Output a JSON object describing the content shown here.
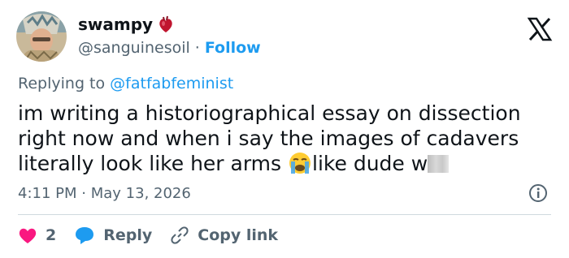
{
  "author": {
    "name": "swampy",
    "handle": "@sanguinesoil",
    "separator": "·",
    "follow_label": "Follow"
  },
  "reply": {
    "prefix": "Replying to",
    "mention": "@fatfabfeminist"
  },
  "tweet": {
    "text_part1": "im writing a historiographical essay on dissection right now and when i say the images of cadavers literally look like her arms ",
    "text_part2": "like dude w"
  },
  "meta": {
    "time": "4:11 PM",
    "separator": "·",
    "date": "May 13, 2026"
  },
  "actions": {
    "like_count": "2",
    "reply_label": "Reply",
    "copy_label": "Copy link"
  },
  "colors": {
    "accent": "#1d9bf0",
    "like": "#f91880",
    "muted": "#536471",
    "text": "#0f1419"
  },
  "icons": [
    "avatar-image",
    "anatomical-heart-icon",
    "x-logo-icon",
    "loudly-crying-face-emoji",
    "info-icon",
    "heart-icon",
    "reply-bubble-icon",
    "link-icon"
  ]
}
